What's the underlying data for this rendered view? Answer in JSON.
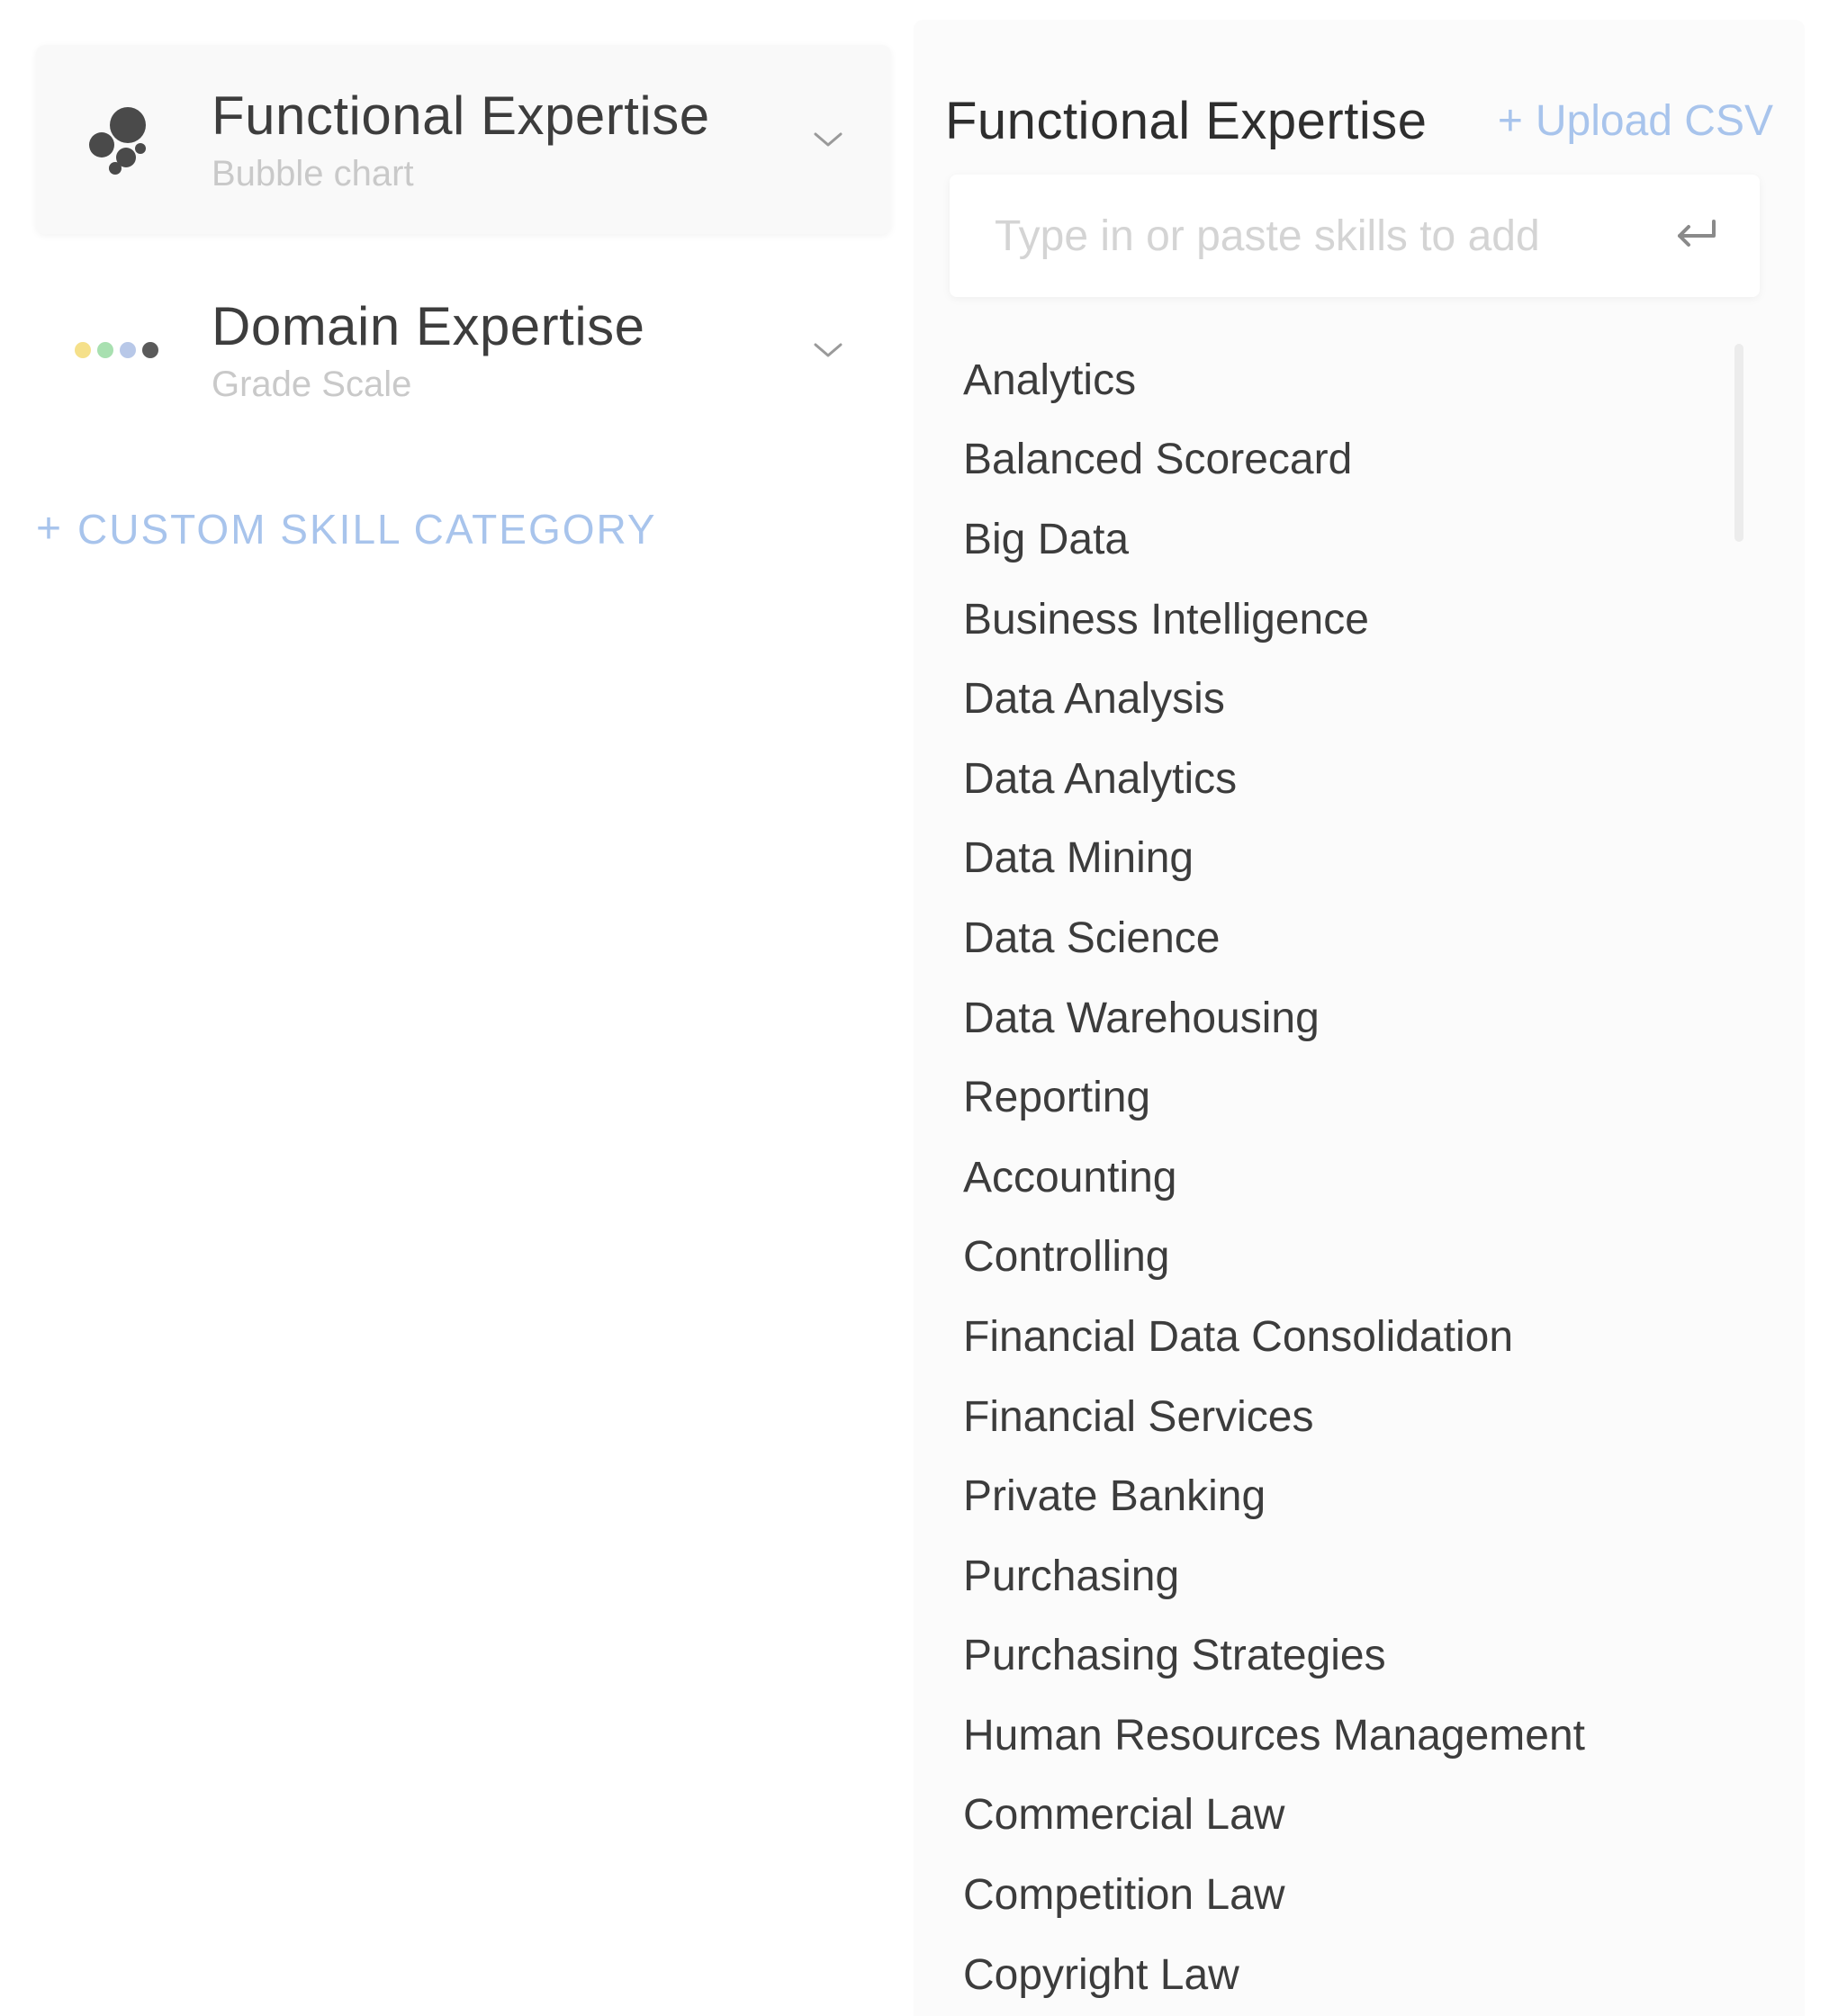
{
  "categories": [
    {
      "title": "Functional Expertise",
      "subtitle": "Bubble chart",
      "icon": "bubble-chart-icon",
      "selected": true
    },
    {
      "title": "Domain Expertise",
      "subtitle": "Grade Scale",
      "icon": "grade-scale-icon",
      "selected": false
    }
  ],
  "add_category_label": "CUSTOM SKILL CATEGORY",
  "add_category_plus": "+",
  "panel": {
    "title": "Functional Expertise",
    "upload_label": "Upload CSV",
    "upload_plus": "+",
    "input_placeholder": "Type in or paste skills to add",
    "input_value": ""
  },
  "skills": [
    "Analytics",
    "Balanced Scorecard",
    "Big Data",
    "Business Intelligence",
    "Data Analysis",
    "Data Analytics",
    "Data Mining",
    "Data Science",
    "Data Warehousing",
    "Reporting",
    "Accounting",
    "Controlling",
    "Financial Data Consolidation",
    "Financial Services",
    "Private Banking",
    "Purchasing",
    "Purchasing Strategies",
    "Human Resources Management",
    "Commercial Law",
    "Competition Law",
    "Copyright Law"
  ],
  "colors": {
    "accent": "#a8c4ec",
    "text_primary": "#3d3d3d",
    "text_muted": "#c9c9c9",
    "panel_bg": "#fbfbfb",
    "scale_yellow": "#f5e08a",
    "scale_green": "#a8e0b0",
    "scale_blue": "#b8c8e8",
    "scale_dark": "#5a5a5a"
  }
}
